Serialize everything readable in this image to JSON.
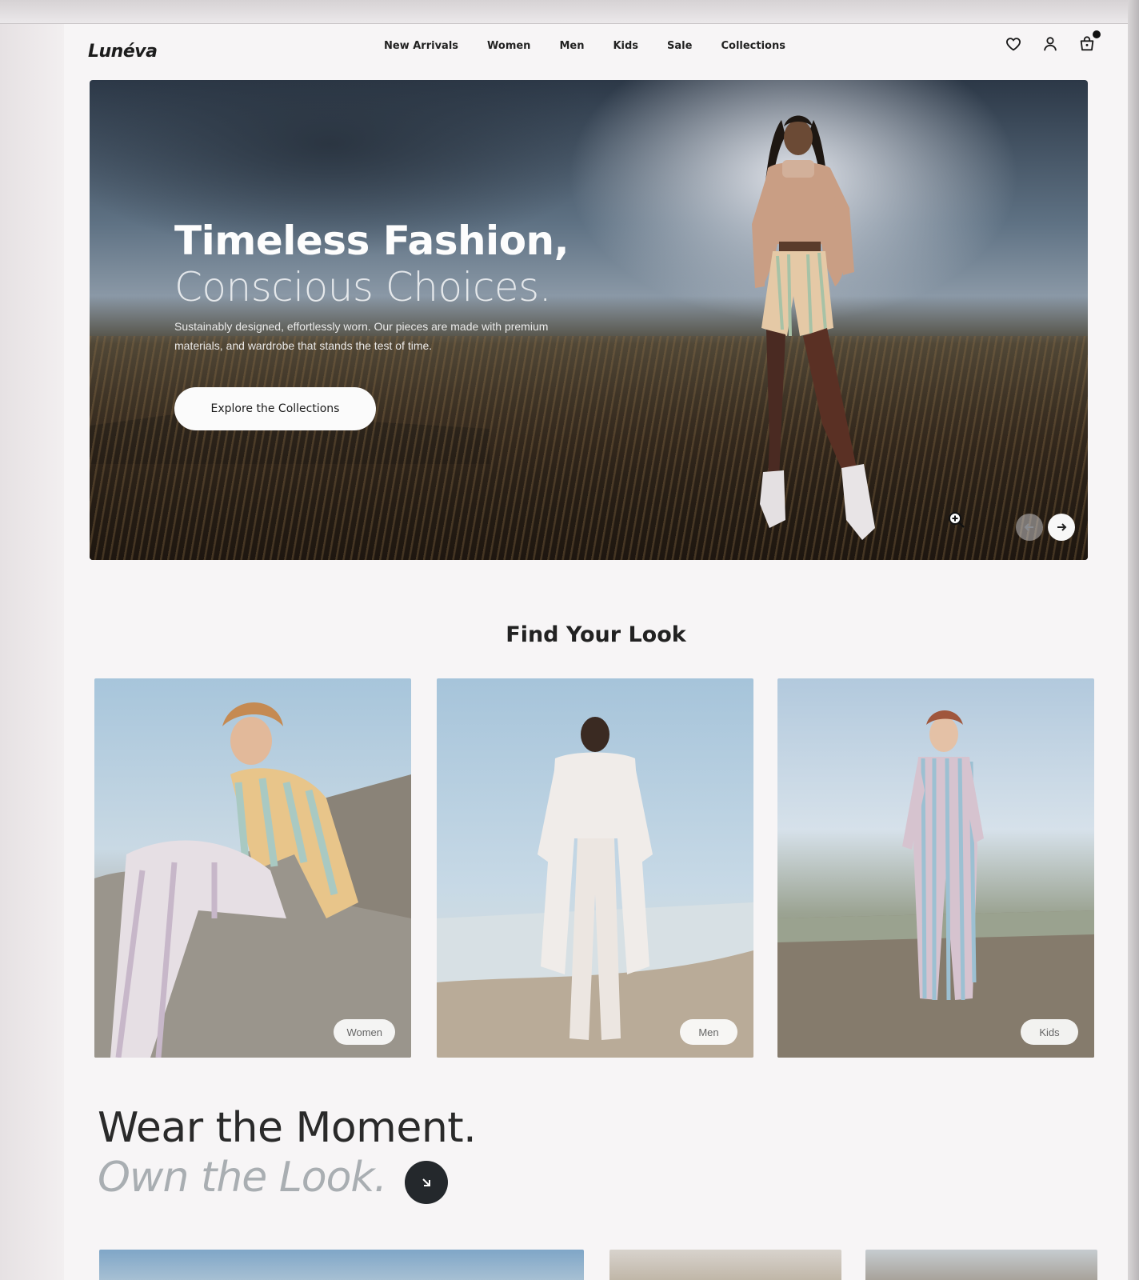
{
  "brand": {
    "logo_text": "Lunéva"
  },
  "nav": {
    "items": [
      {
        "label": "New Arrivals"
      },
      {
        "label": "Women"
      },
      {
        "label": "Men"
      },
      {
        "label": "Kids"
      },
      {
        "label": "Sale"
      },
      {
        "label": "Collections"
      }
    ]
  },
  "header_icons": [
    "heart-icon",
    "user-icon",
    "cart-icon"
  ],
  "hero": {
    "title_line1": "Timeless Fashion,",
    "title_line2": "Conscious Choices.",
    "subtitle": "Sustainably designed, effortlessly worn. Our pieces are made with premium materials, and wardrobe that stands the test of time.",
    "cta_label": "Explore the Collections"
  },
  "find_your_look": {
    "title": "Find Your Look",
    "cards": [
      {
        "label": "Women"
      },
      {
        "label": "Men"
      },
      {
        "label": "Kids"
      }
    ]
  },
  "moment": {
    "line1": "Wear the Moment.",
    "line2": "Own the Look."
  },
  "colors": {
    "text_dark": "#1c1c1c",
    "page_bg": "#f7f5f6",
    "button_dark": "#24282c",
    "hero_cta_bg": "#fbfbfb"
  }
}
